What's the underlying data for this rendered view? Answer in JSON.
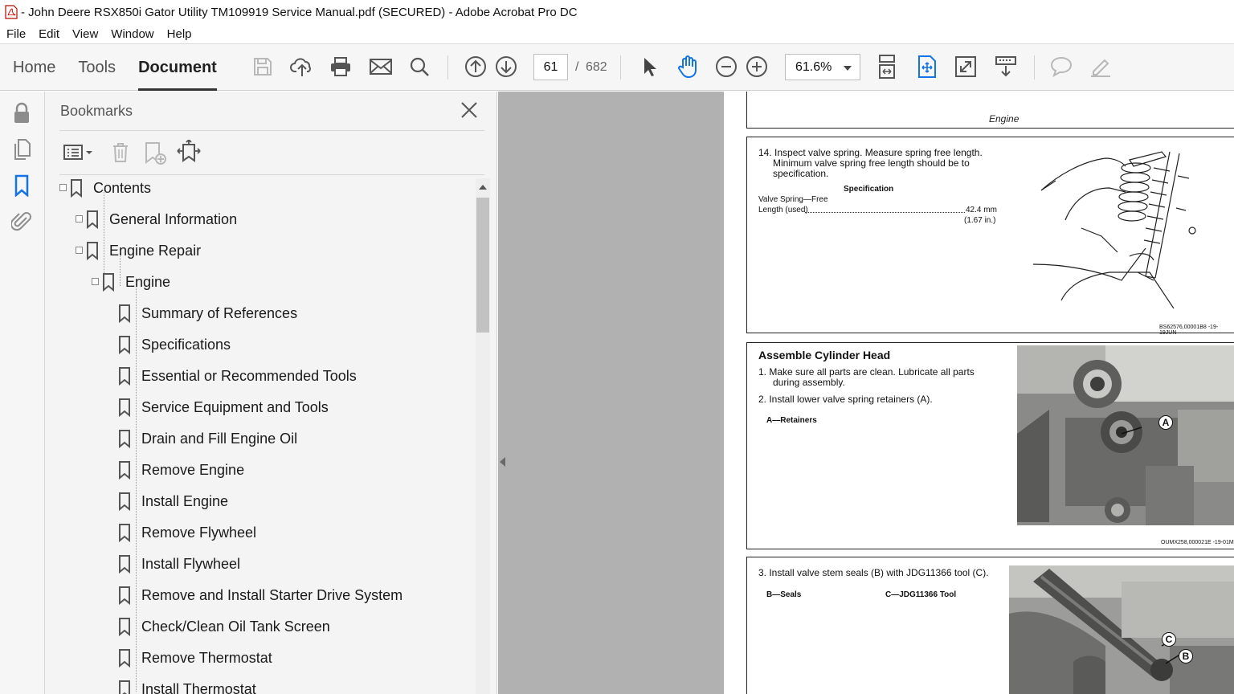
{
  "window": {
    "title": "- John Deere RSX850i Gator Utility TM109919 Service Manual.pdf (SECURED) - Adobe Acrobat Pro DC"
  },
  "menu": [
    "File",
    "Edit",
    "View",
    "Window",
    "Help"
  ],
  "toolbar": {
    "tabs": [
      {
        "label": "Home",
        "active": false
      },
      {
        "label": "Tools",
        "active": false
      },
      {
        "label": "Document",
        "active": true
      }
    ],
    "icons": [
      "save-icon",
      "upload-cloud-icon",
      "print-icon",
      "email-icon",
      "search-icon",
      "page-up-icon",
      "page-down-icon",
      "select-arrow-icon",
      "hand-tool-icon",
      "zoom-out-icon",
      "zoom-in-icon",
      "scroll-mode-icon",
      "fit-page-icon",
      "fullscreen-icon",
      "read-mode-icon",
      "comment-icon",
      "sign-icon"
    ],
    "page_current": "61",
    "page_separator": "/",
    "page_total": "682",
    "zoom": "61.6%",
    "accent": "#1473e6"
  },
  "rail": {
    "icons": [
      "lock-icon",
      "page-thumbnails-icon",
      "bookmark-icon",
      "attachment-icon"
    ]
  },
  "bookmarks": {
    "title": "Bookmarks",
    "items": [
      {
        "label": "Contents",
        "level": 0,
        "expander": true
      },
      {
        "label": "General Information",
        "level": 1,
        "expander": true
      },
      {
        "label": "Engine Repair",
        "level": 1,
        "expander": true
      },
      {
        "label": "Engine",
        "level": 2,
        "expander": true
      },
      {
        "label": "Summary of References",
        "level": 3,
        "expander": false
      },
      {
        "label": "Specifications",
        "level": 3,
        "expander": false
      },
      {
        "label": "Essential or Recommended Tools",
        "level": 3,
        "expander": false
      },
      {
        "label": "Service Equipment and Tools",
        "level": 3,
        "expander": false
      },
      {
        "label": "Drain and Fill Engine Oil",
        "level": 3,
        "expander": false
      },
      {
        "label": "Remove Engine",
        "level": 3,
        "expander": false
      },
      {
        "label": "Install Engine",
        "level": 3,
        "expander": false
      },
      {
        "label": "Remove Flywheel",
        "level": 3,
        "expander": false
      },
      {
        "label": "Install Flywheel",
        "level": 3,
        "expander": false
      },
      {
        "label": "Remove and Install Starter Drive System",
        "level": 3,
        "expander": false
      },
      {
        "label": "Check/Clean Oil Tank Screen",
        "level": 3,
        "expander": false
      },
      {
        "label": "Remove Thermostat",
        "level": 3,
        "expander": false
      },
      {
        "label": "Install Thermostat",
        "level": 3,
        "expander": false
      }
    ]
  },
  "document": {
    "header": "Engine",
    "step14": {
      "line1": "14. Inspect valve spring.  Measure spring free length.",
      "line2": "Minimum valve spring free length should be to",
      "line3": "specification.",
      "spec_title": "Specification",
      "spec_label1": "Valve Spring—Free",
      "spec_label2": "Length (used)",
      "spec_value1": "42.4 mm",
      "spec_value2": "(1.67 in.)",
      "fig_code": "BS62576,00001B8 -19-19JUN"
    },
    "assemble": {
      "heading": "Assemble Cylinder Head",
      "step1a": "1.   Make sure all parts are clean.  Lubricate all parts",
      "step1b": "during assembly.",
      "step2": "2.   Install lower valve spring retainers (A).",
      "legend_a": "A—Retainers",
      "callout_a": "A",
      "fig_code": "OUMX258,000021E -19-01M"
    },
    "step3": {
      "text": "3.   Install valve stem seals (B) with JDG11366 tool (C).",
      "legend_b": "B—Seals",
      "legend_c": "C—JDG11366 Tool",
      "callout_b": "B",
      "callout_c": "C"
    }
  }
}
